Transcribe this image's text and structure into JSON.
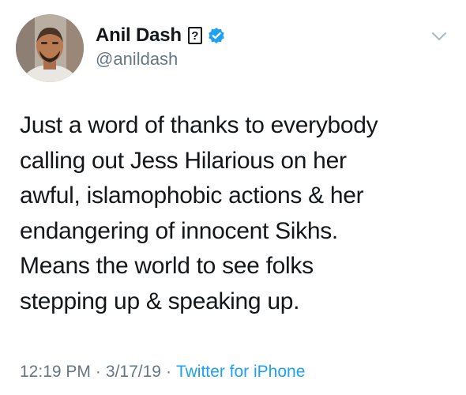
{
  "tweet": {
    "author": {
      "display_name": "Anil Dash",
      "unknown_glyph": "?",
      "verified_icon": "verified-badge-icon",
      "handle": "@anildash",
      "avatar": "profile-photo"
    },
    "menu_icon": "chevron-down-icon",
    "text_lines": [
      "Just a word of thanks to everybody",
      "calling out Jess Hilarious on her",
      "awful, islamophobic actions & her",
      "endangering of innocent Sikhs.",
      "Means the world to see folks",
      "stepping up & speaking up."
    ],
    "time": "12:19 PM",
    "separator": "·",
    "date": "3/17/19",
    "source": "Twitter for iPhone"
  },
  "colors": {
    "text": "#14171a",
    "secondary": "#657786",
    "accent": "#1da1f2",
    "background": "#ffffff"
  }
}
